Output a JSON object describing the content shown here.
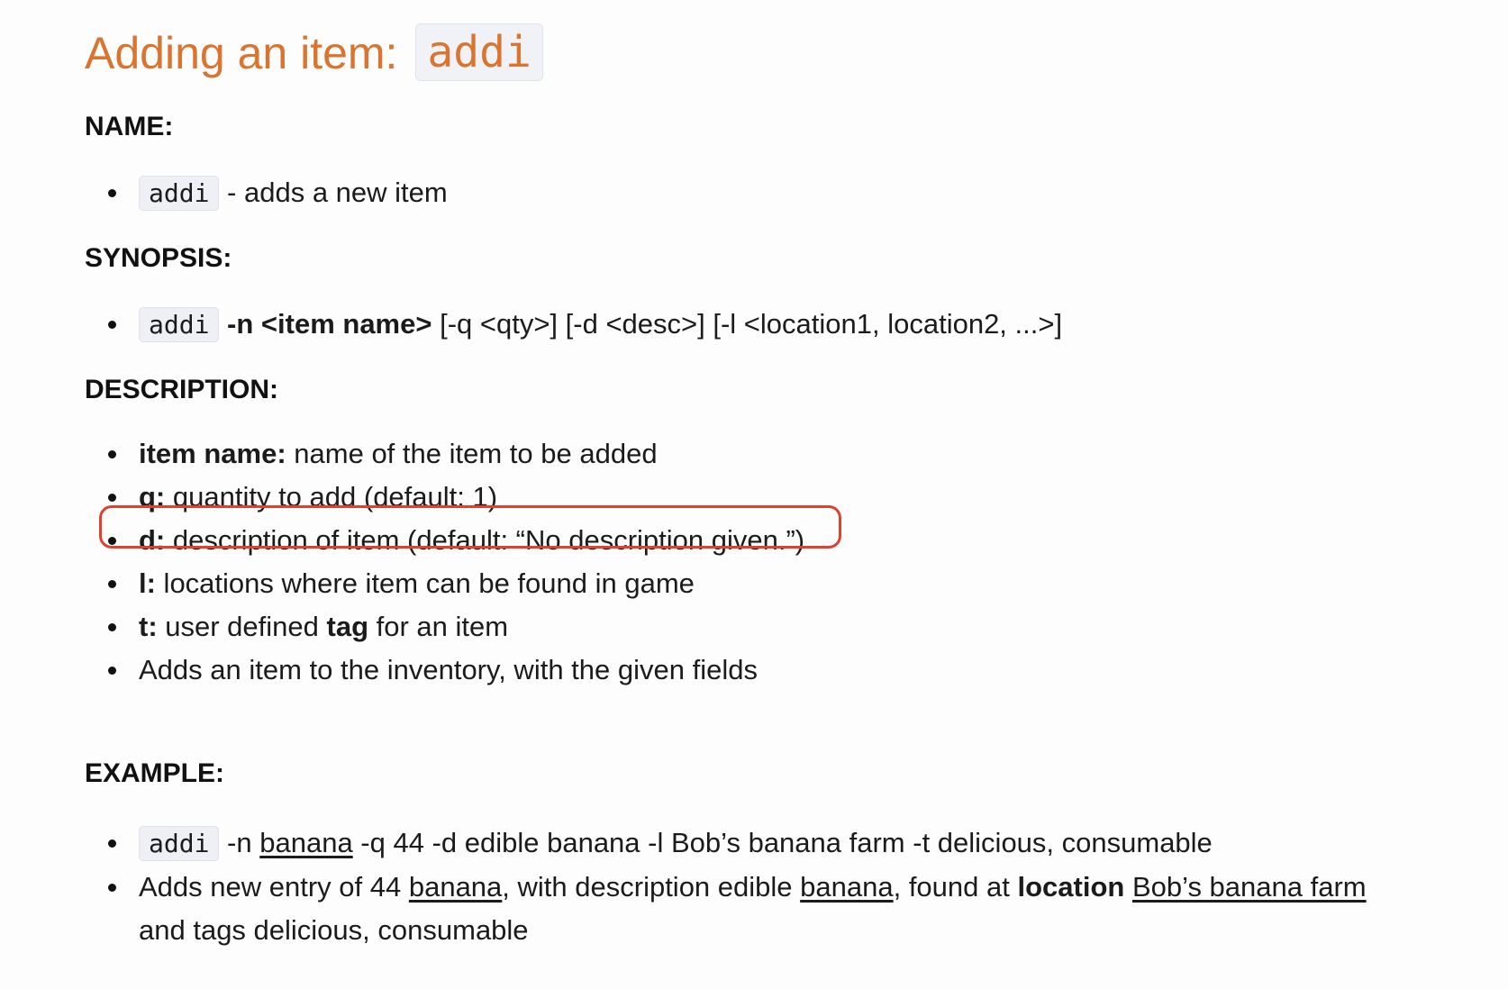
{
  "title": {
    "text": "Adding an item:",
    "command": "addi"
  },
  "name_section": {
    "heading": "NAME:",
    "command": "addi",
    "text": " - adds a new item"
  },
  "synopsis_section": {
    "heading": "SYNOPSIS:",
    "command": "addi",
    "bold_part": " -n <item name>",
    "rest": " [-q <qty>] [-d <desc>] [-l <location1, location2, ...>]"
  },
  "description_section": {
    "heading": "DESCRIPTION:",
    "items": [
      {
        "label": "item name:",
        "text": " name of the item to be added"
      },
      {
        "label": "q:",
        "text": " quantity to add (default: 1)"
      },
      {
        "label": "d:",
        "text": " description of item (default: “No description given.”)"
      },
      {
        "label": "l:",
        "text": " locations where item can be found in game"
      },
      {
        "label": "t:",
        "text_before": " user defined ",
        "bold": "tag",
        "text_after": " for an item"
      },
      {
        "text": "Adds an item to the inventory, with the given fields"
      }
    ]
  },
  "example_section": {
    "heading": "EXAMPLE:",
    "command": "addi",
    "cmd_parts": [
      " -n ",
      "banana",
      " -q 44 -d edible banana -l Bob’s banana farm -t delicious, consumable"
    ],
    "result_parts": [
      "Adds new entry of 44 ",
      "banana",
      ", with description edible ",
      "banana",
      ", found at ",
      "location",
      " ",
      "Bob’s banana farm",
      " and tags delicious, consumable"
    ]
  },
  "annotation": {
    "color": "#e0412e"
  }
}
